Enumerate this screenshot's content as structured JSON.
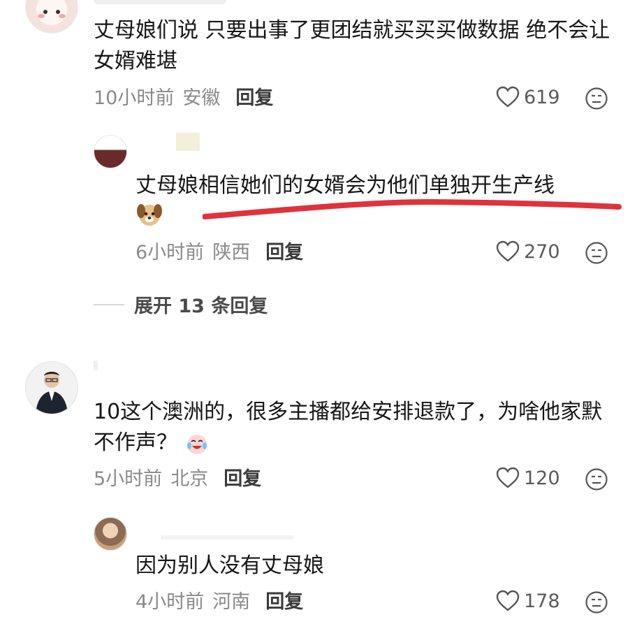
{
  "comments": [
    {
      "text": "丈母娘们说 只要出事了更团结就买买买做数据 绝不会让女婿难堪",
      "time": "10小时前",
      "location": "安徽",
      "reply_label": "回复",
      "likes": "619"
    },
    {
      "text": "丈母娘相信她们的女婿会为他们单独开生产线",
      "time": "6小时前",
      "location": "陕西",
      "reply_label": "回复",
      "likes": "270",
      "emoji": "dog-face-emoji"
    },
    {
      "text": "10这个澳洲的，很多主播都给安排退款了，为啥他家默不作声？",
      "time": "5小时前",
      "location": "北京",
      "reply_label": "回复",
      "likes": "120",
      "emoji": "crying-laughing-emoji"
    },
    {
      "text": "因为别人没有丈母娘",
      "time": "4小时前",
      "location": "河南",
      "reply_label": "回复",
      "likes": "178"
    }
  ],
  "expand_replies": "展开 13 条回复",
  "colors": {
    "underline": "#e0323c",
    "meta": "#8a8a8a",
    "text": "#161616"
  },
  "icons": [
    "heart-icon",
    "dislike-face-icon"
  ]
}
